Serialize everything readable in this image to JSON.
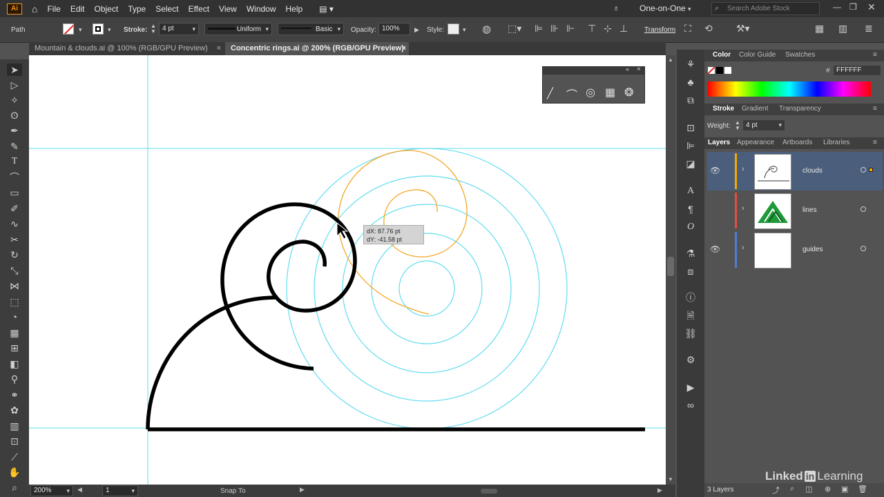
{
  "menubar": {
    "logo": "Ai",
    "items": [
      "File",
      "Edit",
      "Object",
      "Type",
      "Select",
      "Effect",
      "View",
      "Window",
      "Help"
    ],
    "workspace": "One-on-One",
    "search_placeholder": "Search Adobe Stock"
  },
  "control": {
    "selection": "Path",
    "stroke_label": "Stroke:",
    "stroke_weight": "4 pt",
    "profile": "Uniform",
    "brush": "Basic",
    "opacity_label": "Opacity:",
    "opacity": "100%",
    "style_label": "Style:",
    "transform": "Transform"
  },
  "tabs": [
    {
      "label": "Mountain & clouds.ai @ 100% (RGB/GPU Preview)",
      "close": "×"
    },
    {
      "label": "Concentric rings.ai @ 200% (RGB/GPU Preview)",
      "close": "×"
    }
  ],
  "tooltip": {
    "dx": "dX: 87.76 pt",
    "dy": "dY: -41.58 pt"
  },
  "status": {
    "zoom": "200%",
    "artboard": "1",
    "snap": "Snap To"
  },
  "panels": {
    "color_tabs": [
      "Color",
      "Color Guide",
      "Swatches"
    ],
    "hex_label": "#",
    "hex": "FFFFFF",
    "stroke_tabs": [
      "Stroke",
      "Gradient",
      "Transparency"
    ],
    "weight_label": "Weight:",
    "weight": "4 pt",
    "layer_tabs": [
      "Layers",
      "Appearance",
      "Artboards",
      "Libraries"
    ],
    "layers": [
      {
        "name": "clouds",
        "color": "#f7a800"
      },
      {
        "name": "lines",
        "color": "#e84c3d"
      },
      {
        "name": "guides",
        "color": "#4a7fd6"
      }
    ],
    "layer_count": "3 Layers"
  },
  "brand": {
    "linked": "Linked",
    "in": "in",
    "learning": "Learning"
  },
  "colors": {
    "guide": "#5fdcf0",
    "spiral": "#f5a623",
    "accent": "#f7931e"
  }
}
